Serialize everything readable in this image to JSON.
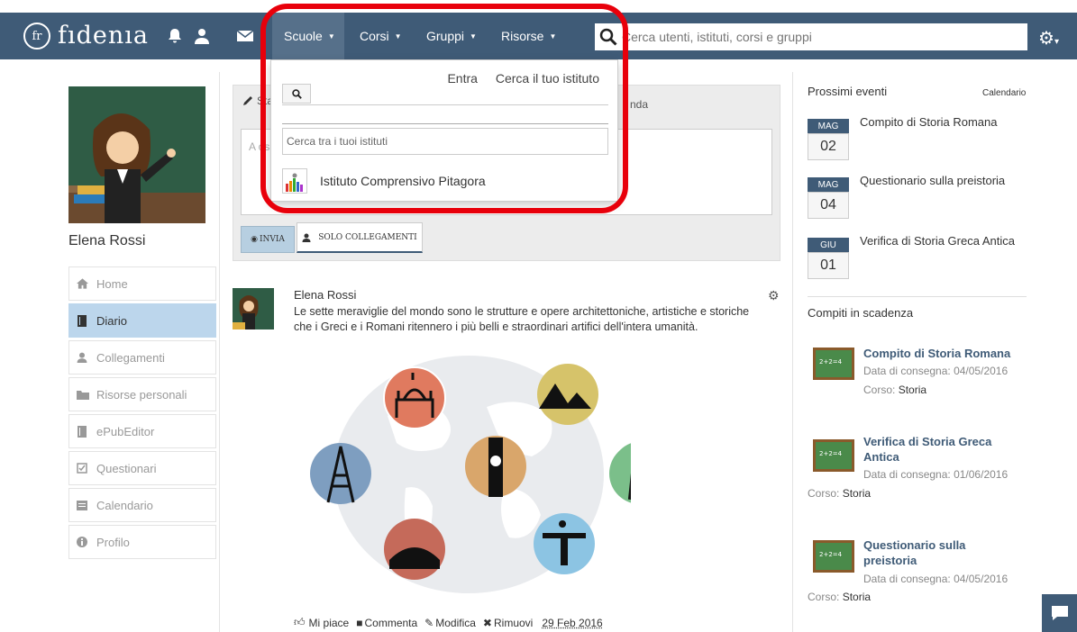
{
  "navbar": {
    "logo_mark": "fr",
    "logo_text": "fıdenıa",
    "menus": [
      {
        "label": "Scuole"
      },
      {
        "label": "Corsi"
      },
      {
        "label": "Gruppi"
      },
      {
        "label": "Risorse"
      }
    ],
    "search_placeholder": "Cerca utenti, istituti, corsi e gruppi",
    "colors": {
      "bar": "#3f5b77",
      "active": "#56708a"
    }
  },
  "dropdown": {
    "enter_label": "Entra",
    "find_label": "Cerca il tuo istituto",
    "filter_placeholder": "Cerca tra i tuoi istituti",
    "items": [
      {
        "label": "Istituto Comprensivo Pitagora"
      }
    ]
  },
  "sidebar": {
    "profile_name": "Elena Rossi",
    "items": [
      {
        "label": "Home",
        "icon": "home-icon"
      },
      {
        "label": "Diario",
        "icon": "book-icon"
      },
      {
        "label": "Collegamenti",
        "icon": "user-icon"
      },
      {
        "label": "Risorse personali",
        "icon": "folder-icon"
      },
      {
        "label": "ePubEditor",
        "icon": "book-icon"
      },
      {
        "label": "Questionari",
        "icon": "checkbox-icon"
      },
      {
        "label": "Calendario",
        "icon": "calendar-icon"
      },
      {
        "label": "Profilo",
        "icon": "info-icon"
      }
    ]
  },
  "composer": {
    "head_left": "Sta",
    "head_right": "nda",
    "placeholder": "A os",
    "send_label": "INVIA",
    "connections_label": "SOLO COLLEGAMENTI"
  },
  "post": {
    "author": "Elena Rossi",
    "text": "Le sette meraviglie del mondo sono le strutture e opere architettoniche, artistiche e storiche che i Greci e i Romani ritennero i più belli e straordinari artifici dell'intera umanità.",
    "like_label": "Mi piace",
    "comment_label": "Commenta",
    "edit_label": "Modifica",
    "remove_label": "Rimuovi",
    "date": "29 Feb 2016"
  },
  "events": {
    "title": "Prossimi eventi",
    "calendar_link": "Calendario",
    "items": [
      {
        "month": "MAG",
        "day": "02",
        "title": "Compito di Storia Romana"
      },
      {
        "month": "MAG",
        "day": "04",
        "title": "Questionario sulla preistoria"
      },
      {
        "month": "GIU",
        "day": "01",
        "title": "Verifica di Storia Greca Antica"
      }
    ]
  },
  "tasks": {
    "title": "Compiti in scadenza",
    "deadline_label": "Data di consegna:",
    "course_label": "Corso:",
    "items": [
      {
        "title": "Compito di Storia Romana",
        "date": "04/05/2016",
        "course": "Storia"
      },
      {
        "title": "Verifica di Storia Greca Antica",
        "date": "01/06/2016",
        "course": "Storia"
      },
      {
        "title": "Questionario sulla preistoria",
        "date": "04/05/2016",
        "course": "Storia"
      }
    ]
  }
}
